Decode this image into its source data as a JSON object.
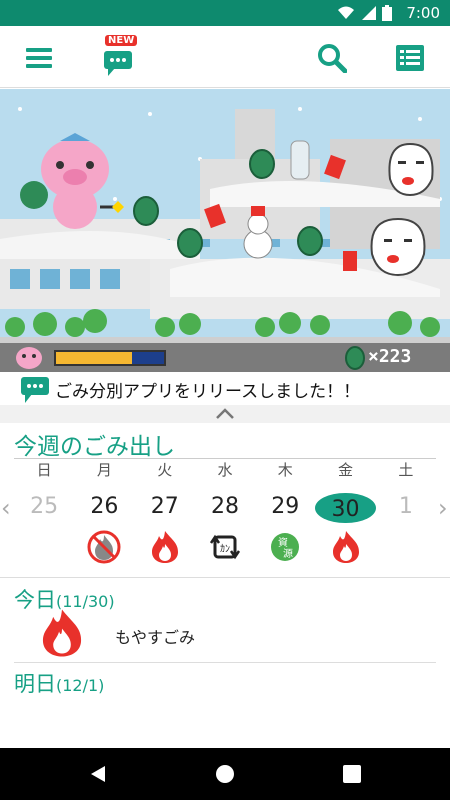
{
  "status_bar": {
    "time": "7:00",
    "battery": "7"
  },
  "header": {
    "menu_icon": "hamburger-icon",
    "news_icon": "chat-bubble-icon",
    "news_badge": "NEW",
    "search_icon": "search-icon",
    "list_icon": "list-icon"
  },
  "banner": {
    "leaf_count": "×223"
  },
  "news": {
    "text": "ごみ分別アプリをリリースしました！！"
  },
  "week": {
    "title": "今週のごみ出し",
    "weekdays": [
      "日",
      "月",
      "火",
      "水",
      "木",
      "金",
      "土"
    ],
    "dates": [
      "25",
      "26",
      "27",
      "28",
      "29",
      "30",
      "1"
    ],
    "today_index": 5,
    "garbage": [
      "",
      "no-burnable",
      "burnable",
      "recyclable",
      "resource",
      "burnable",
      ""
    ]
  },
  "today": {
    "label": "今日",
    "date": "(11/30)",
    "item": "もやすごみ"
  },
  "tomorrow": {
    "label": "明日",
    "date": "(12/1)"
  },
  "colors": {
    "accent": "#17a085",
    "status": "#0e8a6e",
    "fire": "#e8312b"
  }
}
